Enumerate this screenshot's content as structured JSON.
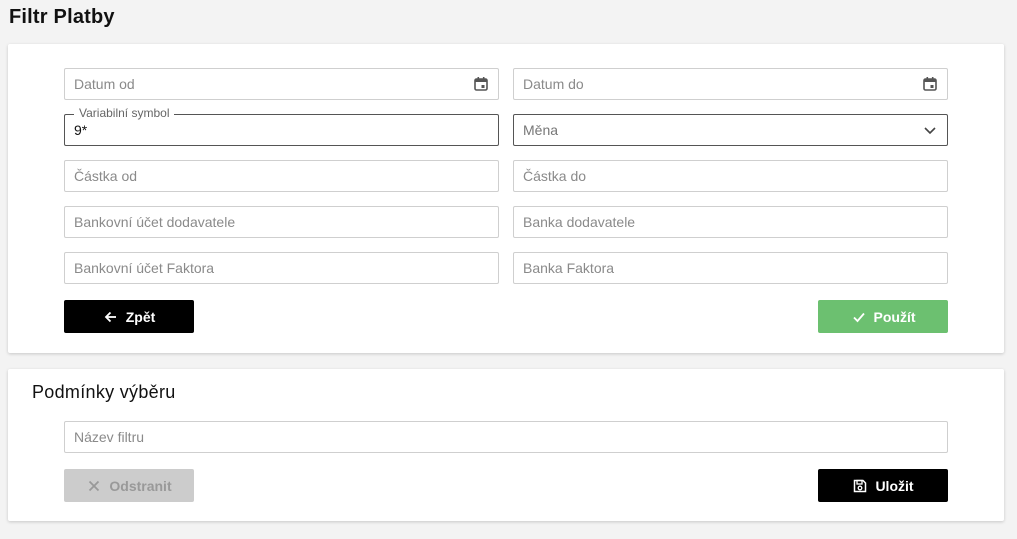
{
  "page": {
    "title": "Filtr Platby"
  },
  "filter": {
    "date_from": {
      "placeholder": "Datum od",
      "icon": "calendar-icon"
    },
    "date_to": {
      "placeholder": "Datum do",
      "icon": "calendar-icon"
    },
    "variable_symbol": {
      "label": "Variabilní symbol",
      "value": "9*"
    },
    "currency": {
      "placeholder": "Měna",
      "icon": "chevron-down-icon"
    },
    "amount_from": {
      "placeholder": "Částka od"
    },
    "amount_to": {
      "placeholder": "Částka do"
    },
    "supplier_account": {
      "placeholder": "Bankovní účet dodavatele"
    },
    "supplier_bank": {
      "placeholder": "Banka dodavatele"
    },
    "factor_account": {
      "placeholder": "Bankovní účet Faktora"
    },
    "factor_bank": {
      "placeholder": "Banka Faktora"
    },
    "back_label": "Zpět",
    "apply_label": "Použít"
  },
  "conditions": {
    "title": "Podmínky výběru",
    "filter_name": {
      "placeholder": "Název filtru"
    },
    "remove_label": "Odstranit",
    "save_label": "Uložit"
  },
  "colors": {
    "apply_button": "#6cc070",
    "primary_button": "#000000",
    "disabled_button": "#cccccc",
    "page_background": "#f3f3f3"
  }
}
